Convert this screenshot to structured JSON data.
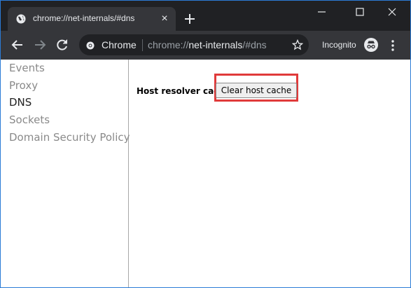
{
  "browser": {
    "tab": {
      "title": "chrome://net-internals/#dns",
      "favicon": "globe-icon",
      "close": "×"
    },
    "omnibox": {
      "origin_chip": "Chrome",
      "url_scheme": "chrome://",
      "url_host": "net-internals",
      "url_path": "/#dns"
    },
    "profile_label": "Incognito",
    "colors": {
      "frame": "#202124",
      "toolbar": "#35363a",
      "omnibox": "#202124",
      "accent_border": "#2b7bd6"
    }
  },
  "sidebar": {
    "items": [
      {
        "label": "Events",
        "active": false
      },
      {
        "label": "Proxy",
        "active": false
      },
      {
        "label": "DNS",
        "active": true
      },
      {
        "label": "Sockets",
        "active": false
      },
      {
        "label": "Domain Security Policy",
        "active": false
      }
    ]
  },
  "dns": {
    "resolver_label": "Host resolver cache",
    "clear_button": "Clear host cache",
    "highlight_color": "#e03a3a"
  }
}
